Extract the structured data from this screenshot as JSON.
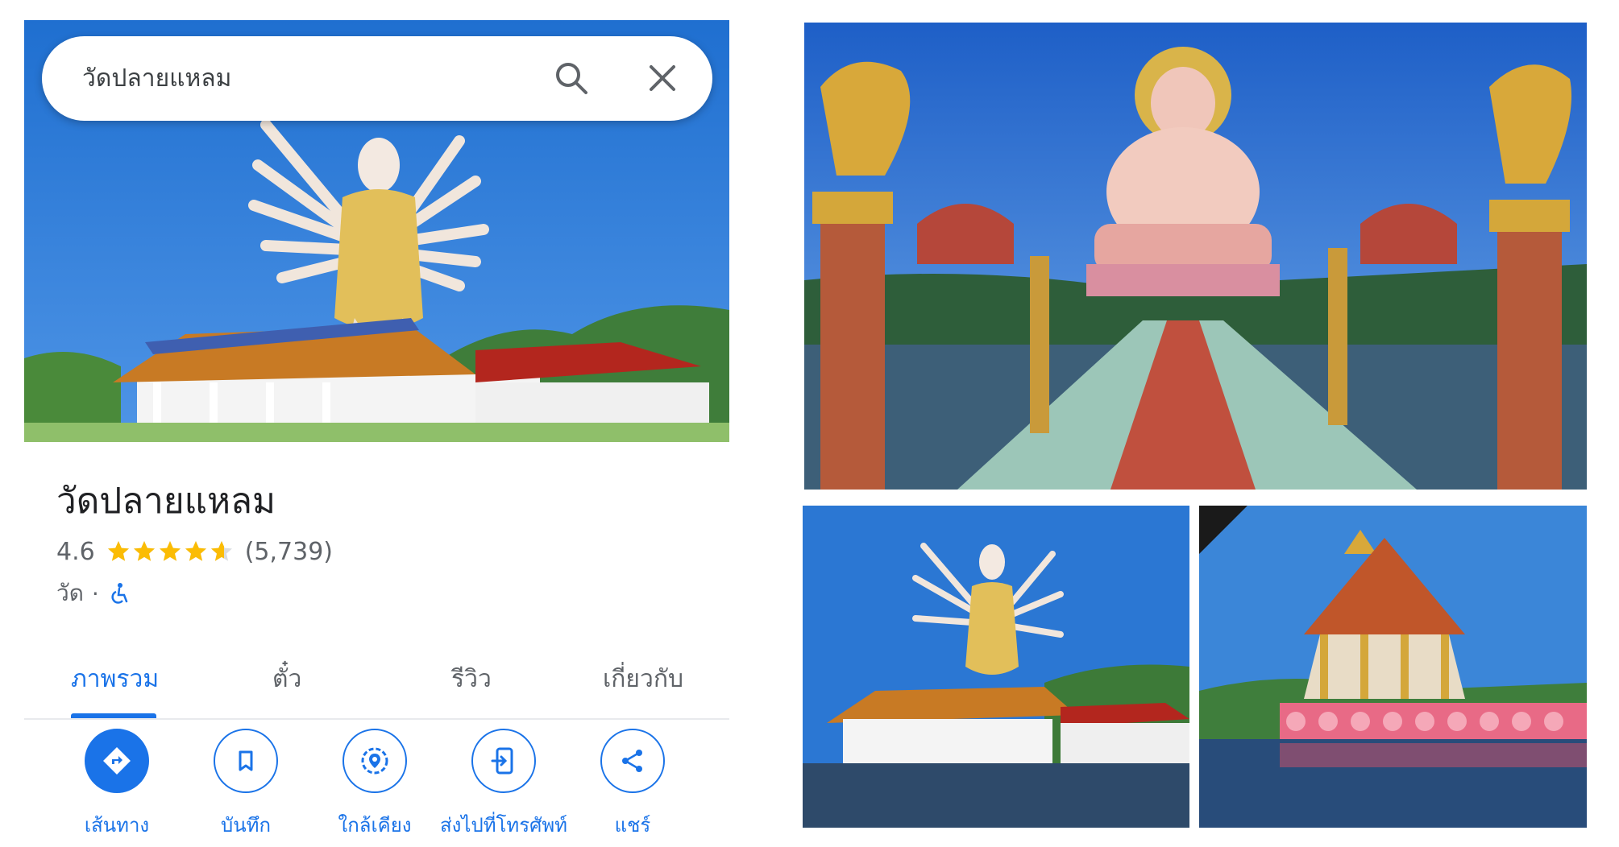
{
  "search": {
    "query": "วัดปลายแหลม"
  },
  "place": {
    "name": "วัดปลายแหลม",
    "rating": "4.6",
    "rating_stars": 4.6,
    "review_count": "(5,739)",
    "category": "วัด",
    "separator": "·"
  },
  "tabs": [
    {
      "label": "ภาพรวม",
      "active": true
    },
    {
      "label": "ตั๋ว",
      "active": false
    },
    {
      "label": "รีวิว",
      "active": false
    },
    {
      "label": "เกี่ยวกับ",
      "active": false
    }
  ],
  "actions": [
    {
      "label": "เส้นทาง",
      "icon": "directions-icon"
    },
    {
      "label": "บันทึก",
      "icon": "bookmark-icon"
    },
    {
      "label": "ใกล้เคียง",
      "icon": "nearby-icon"
    },
    {
      "label": "ส่งไปที่โทรศัพท์",
      "icon": "send-to-phone-icon"
    },
    {
      "label": "แชร์",
      "icon": "share-icon"
    }
  ],
  "colors": {
    "accent": "#1a73e8",
    "star": "#fbbc04",
    "text_secondary": "#5f6368",
    "sky": "#2a78d6"
  }
}
